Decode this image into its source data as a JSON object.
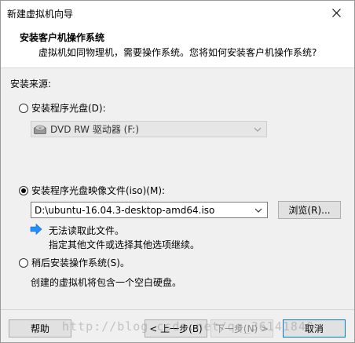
{
  "window": {
    "title": "新建虚拟机向导"
  },
  "header": {
    "title": "安装客户机操作系统",
    "subtitle": "虚拟机如同物理机，需要操作系统。您将如何安装客户机操作系统?"
  },
  "install_source": {
    "label": "安装来源:",
    "disc_option": {
      "label": "安装程序光盘(D):",
      "selected": false
    },
    "drive_select": {
      "value": "DVD RW 驱动器 (F:)"
    },
    "iso_option": {
      "label": "安装程序光盘映像文件(iso)(M):",
      "selected": true
    },
    "iso_path": {
      "value": "D:\\ubuntu-16.04.3-desktop-amd64.iso"
    },
    "browse_label": "浏览(R)...",
    "iso_message": {
      "line1": "无法读取此文件。",
      "line2": "指定其他文件或选择其他选项继续。"
    },
    "later_option": {
      "label": "稍后安装操作系统(S)。",
      "selected": false
    },
    "later_description": "创建的虚拟机将包含一个空白硬盘。"
  },
  "footer": {
    "help_label": "帮助",
    "back_label": "< 上一步(B)",
    "next_label": "下一步(N) >",
    "cancel_label": "取消"
  },
  "watermark": "http://blog.csdn.net/qq_36141840"
}
